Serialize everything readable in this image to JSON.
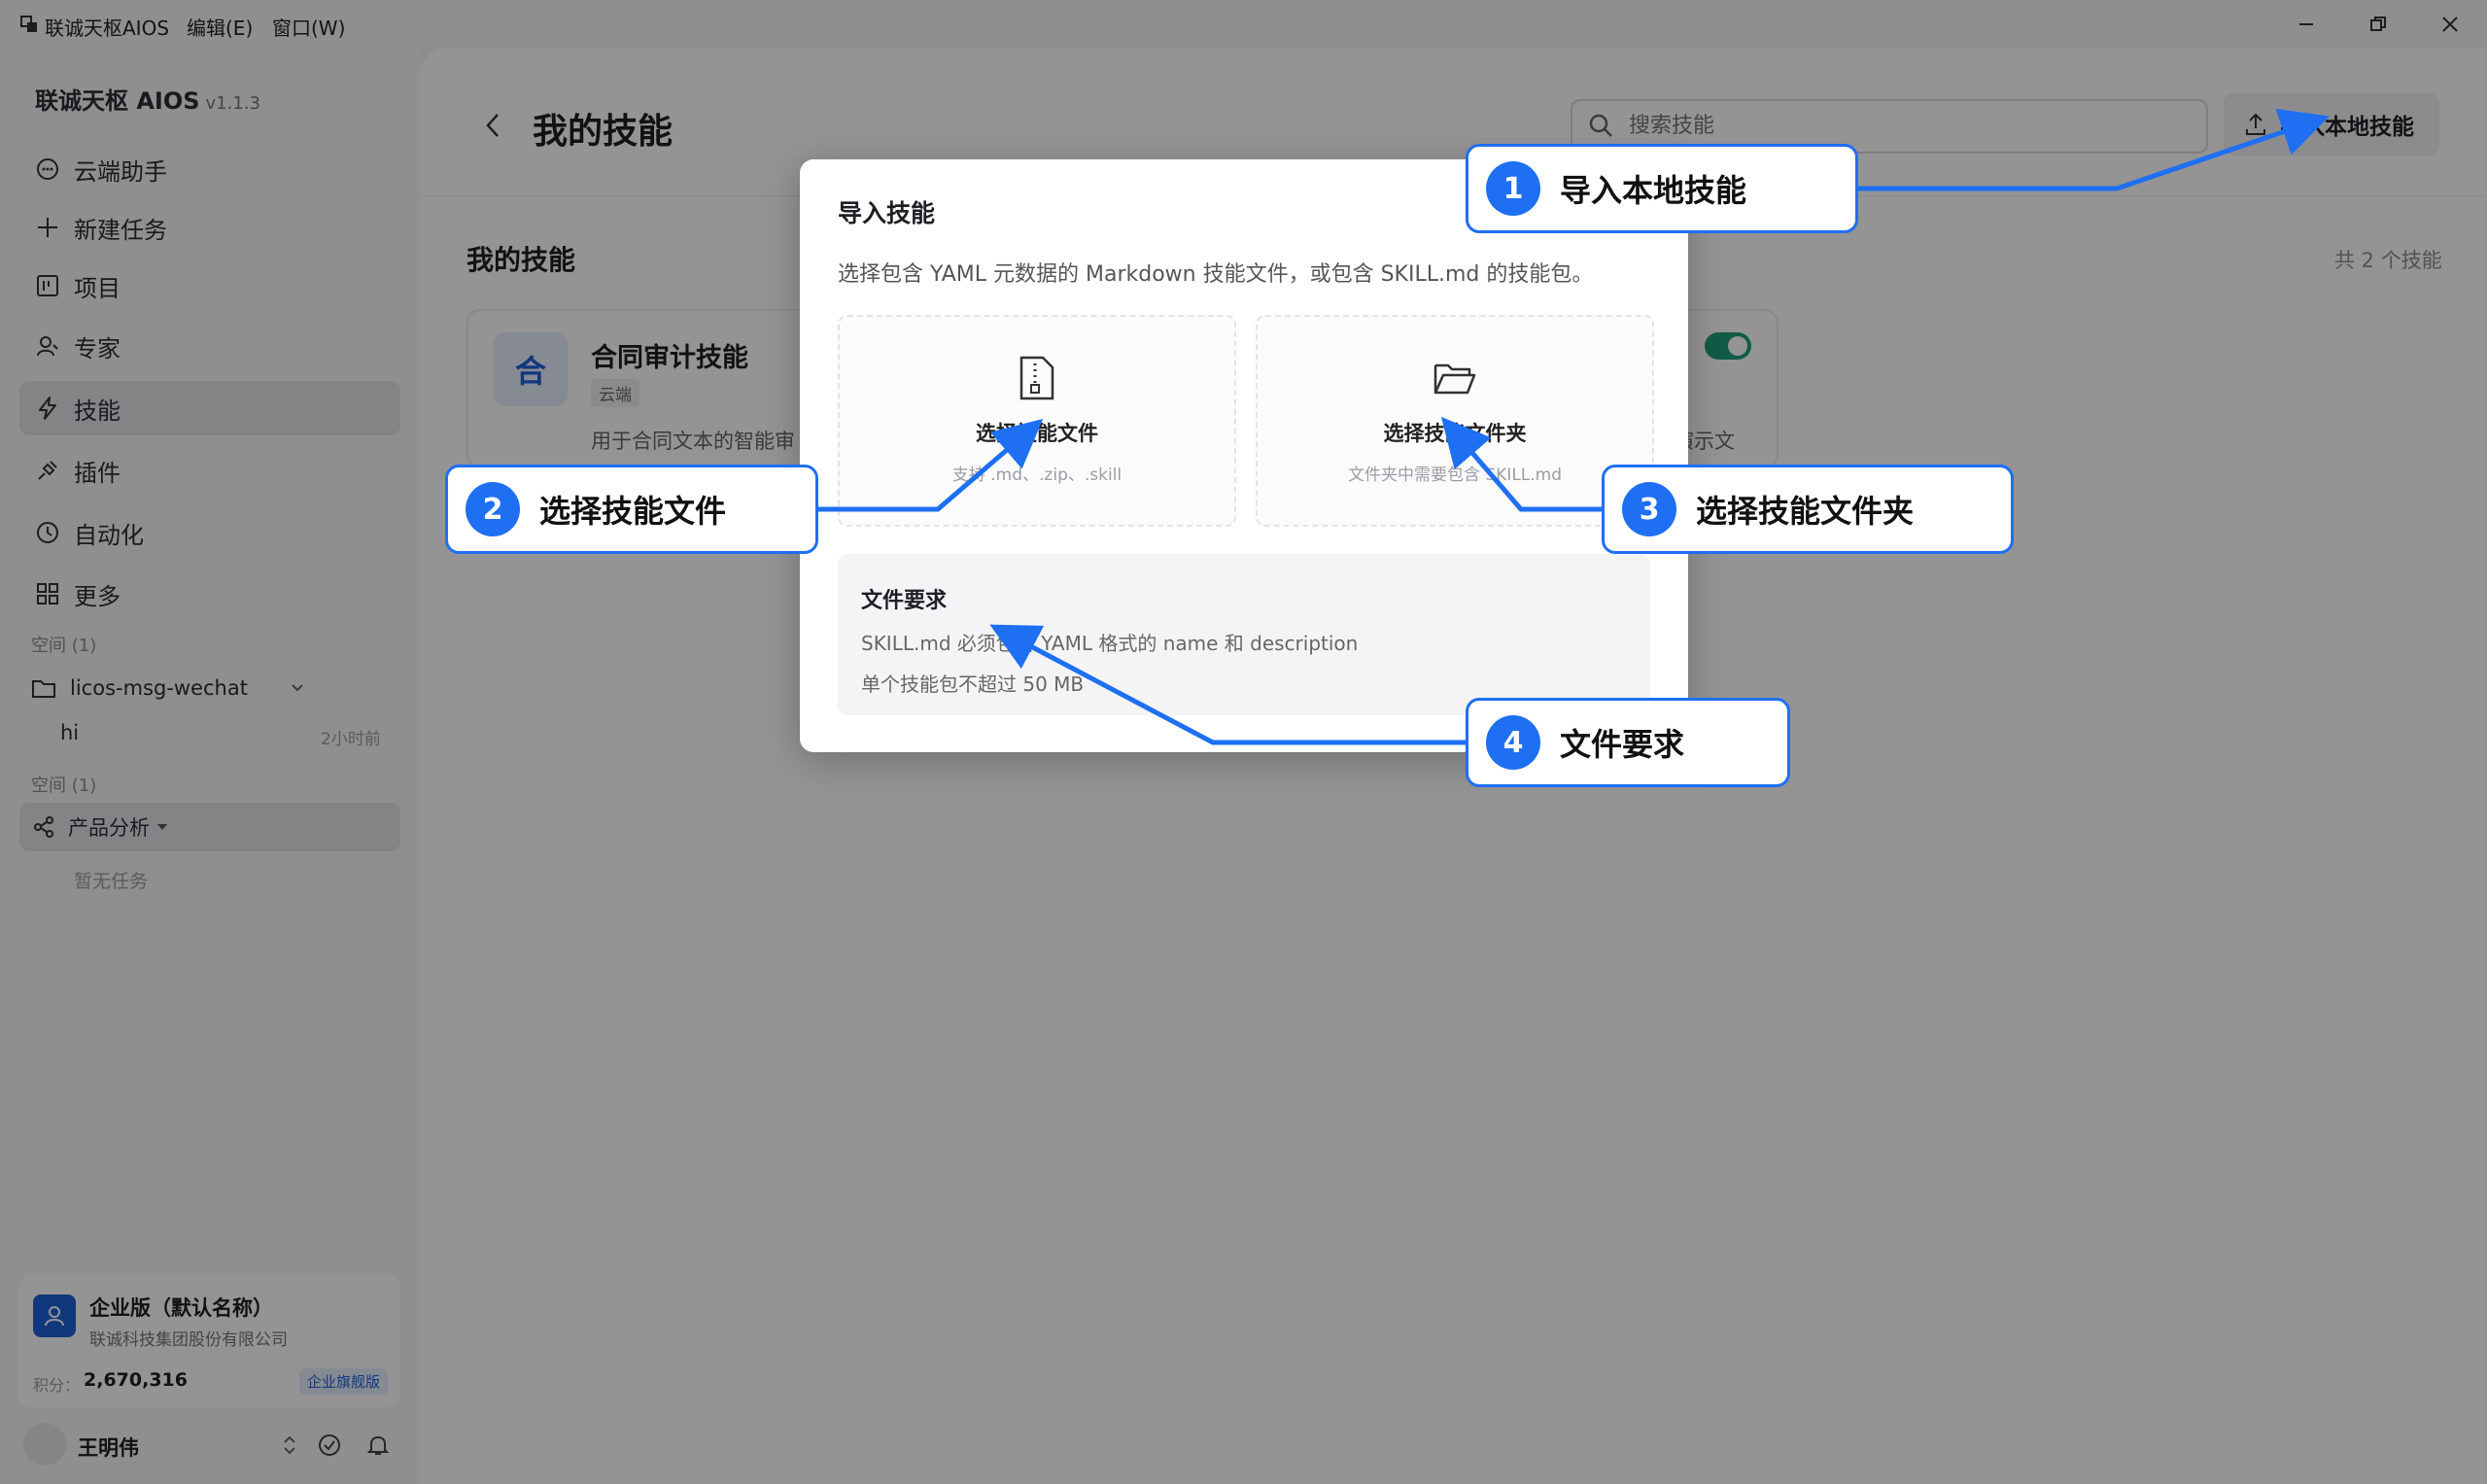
{
  "titlebar": {
    "app_name": "联诚天枢AIOS",
    "menu": [
      "编辑(E)",
      "窗口(W)"
    ]
  },
  "sidebar": {
    "brand": "联诚天枢 AIOS",
    "version": "v1.1.3",
    "nav": [
      {
        "label": "云端助手",
        "icon": "chat-bubble-icon"
      },
      {
        "label": "新建任务",
        "icon": "plus-icon"
      },
      {
        "label": "项目",
        "icon": "project-board-icon"
      },
      {
        "label": "专家",
        "icon": "expert-icon"
      },
      {
        "label": "技能",
        "icon": "lightning-icon",
        "active": true
      },
      {
        "label": "插件",
        "icon": "plug-icon"
      },
      {
        "label": "自动化",
        "icon": "clock-icon"
      },
      {
        "label": "更多",
        "icon": "grid-icon"
      }
    ],
    "space1": {
      "label": "空间 (1)",
      "folder": "licos-msg-wechat",
      "task": "hi",
      "task_time": "2小时前"
    },
    "space2": {
      "label": "空间 (1)",
      "group": "产品分析",
      "empty": "暂无任务"
    },
    "org": {
      "name": "企业版（默认名称）",
      "company": "联诚科技集团股份有限公司",
      "points_label": "积分：",
      "points": "2,670,316",
      "badge": "企业旗舰版"
    },
    "user": {
      "name": "王明伟"
    }
  },
  "main": {
    "title": "我的技能",
    "search_placeholder": "搜索技能",
    "import_button": "导入本地技能",
    "section_title": "我的技能",
    "count": "共 2 个技能",
    "card": {
      "avatar": "合",
      "name": "合同审计技能",
      "tag": "云端",
      "desc": "用于合同文本的智能审",
      "desc_tail": "演示文"
    }
  },
  "dialog": {
    "title": "导入技能",
    "desc": "选择包含 YAML 元数据的 Markdown 技能文件，或包含 SKILL.md 的技能包。",
    "file": {
      "title": "选择技能文件",
      "sub": "支持 .md、.zip、.skill"
    },
    "folder": {
      "title": "选择技能文件夹",
      "sub": "文件夹中需要包含 SKILL.md"
    },
    "req": {
      "title": "文件要求",
      "line1": "SKILL.md 必须包含 YAML 格式的 name 和 description",
      "line2": "单个技能包不超过 50 MB"
    }
  },
  "callouts": [
    {
      "num": "1",
      "text": "导入本地技能"
    },
    {
      "num": "2",
      "text": "选择技能文件"
    },
    {
      "num": "3",
      "text": "选择技能文件夹"
    },
    {
      "num": "4",
      "text": "文件要求"
    }
  ],
  "colors": {
    "accent": "#1e6ff2",
    "toggle": "#1f9e7a",
    "overlay": "rgba(0,0,0,0.42)"
  }
}
